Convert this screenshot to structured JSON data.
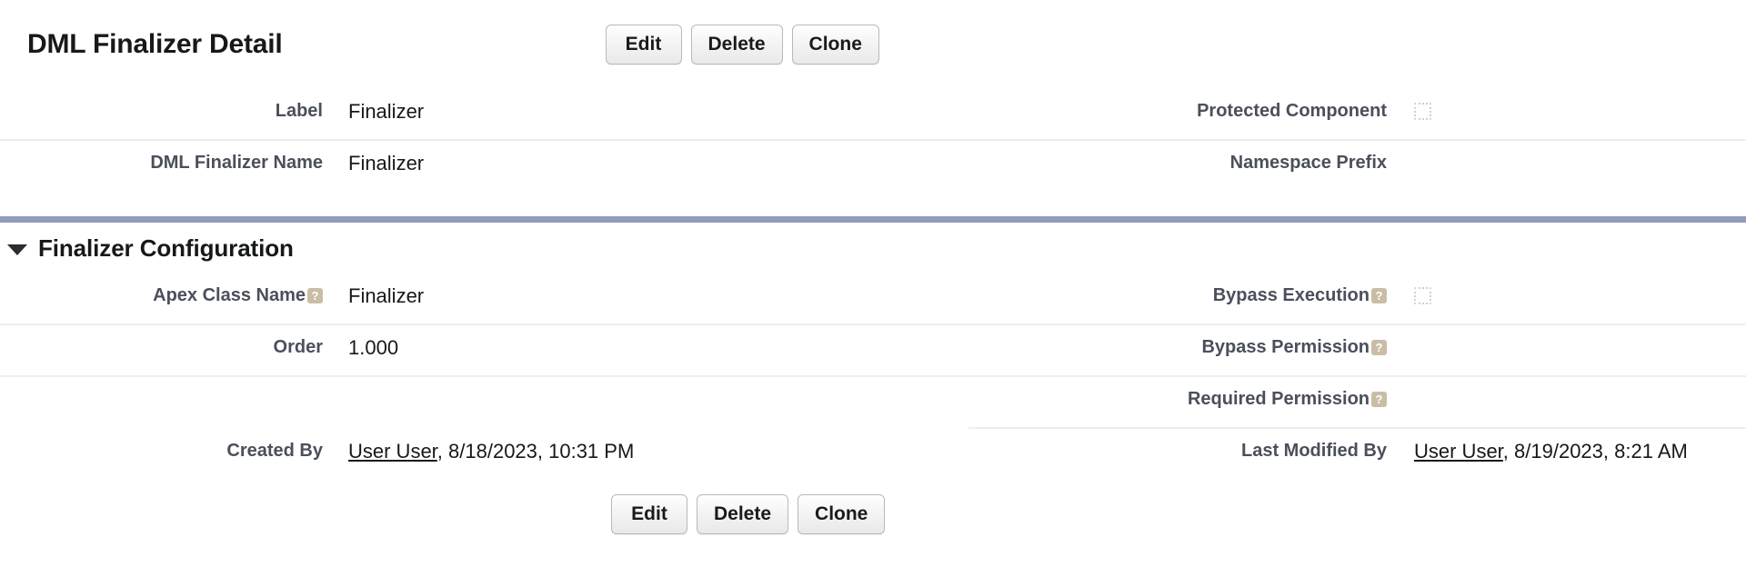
{
  "header": {
    "title": "DML Finalizer Detail",
    "buttons": [
      {
        "label": "Edit",
        "name": "edit-button"
      },
      {
        "label": "Delete",
        "name": "delete-button"
      },
      {
        "label": "Clone",
        "name": "clone-button"
      }
    ]
  },
  "top_section": {
    "rows": [
      {
        "left": {
          "label": "Label",
          "value": "Finalizer"
        },
        "right": {
          "label": "Protected Component",
          "value": "",
          "control": "checkbox-unchecked"
        }
      },
      {
        "left": {
          "label": "DML Finalizer Name",
          "value": "Finalizer"
        },
        "right": {
          "label": "Namespace Prefix",
          "value": ""
        }
      }
    ]
  },
  "finalizer_section": {
    "title": "Finalizer Configuration",
    "expanded": true,
    "twisty_icon": "caret-down-icon",
    "rows": [
      {
        "left": {
          "label": "Apex Class Name",
          "help": "?",
          "value": "Finalizer"
        },
        "right": {
          "label": "Bypass Execution",
          "help": "?",
          "value": "",
          "control": "checkbox-unchecked"
        }
      },
      {
        "left": {
          "label": "Order",
          "value": "1.000"
        },
        "right": {
          "label": "Bypass Permission",
          "help": "?",
          "value": ""
        }
      },
      {
        "left": {
          "label": "",
          "value": ""
        },
        "right": {
          "label": "Required Permission",
          "help": "?",
          "value": ""
        }
      }
    ],
    "audit": {
      "created_by": {
        "label": "Created By",
        "user": "User User",
        "timestamp": ", 8/18/2023, 10:31 PM"
      },
      "last_modified_by": {
        "label": "Last Modified By",
        "user": "User User",
        "timestamp": ", 8/19/2023, 8:21 AM"
      }
    }
  },
  "footer": {
    "buttons": [
      {
        "label": "Edit",
        "name": "edit-button"
      },
      {
        "label": "Delete",
        "name": "delete-button"
      },
      {
        "label": "Clone",
        "name": "clone-button"
      }
    ]
  },
  "colors": {
    "section_bar": "#919bba",
    "label_text": "#4b4f5b",
    "value_text": "#16181a",
    "help_icon": "#c9bda6",
    "row_divider": "#eeeeee"
  }
}
